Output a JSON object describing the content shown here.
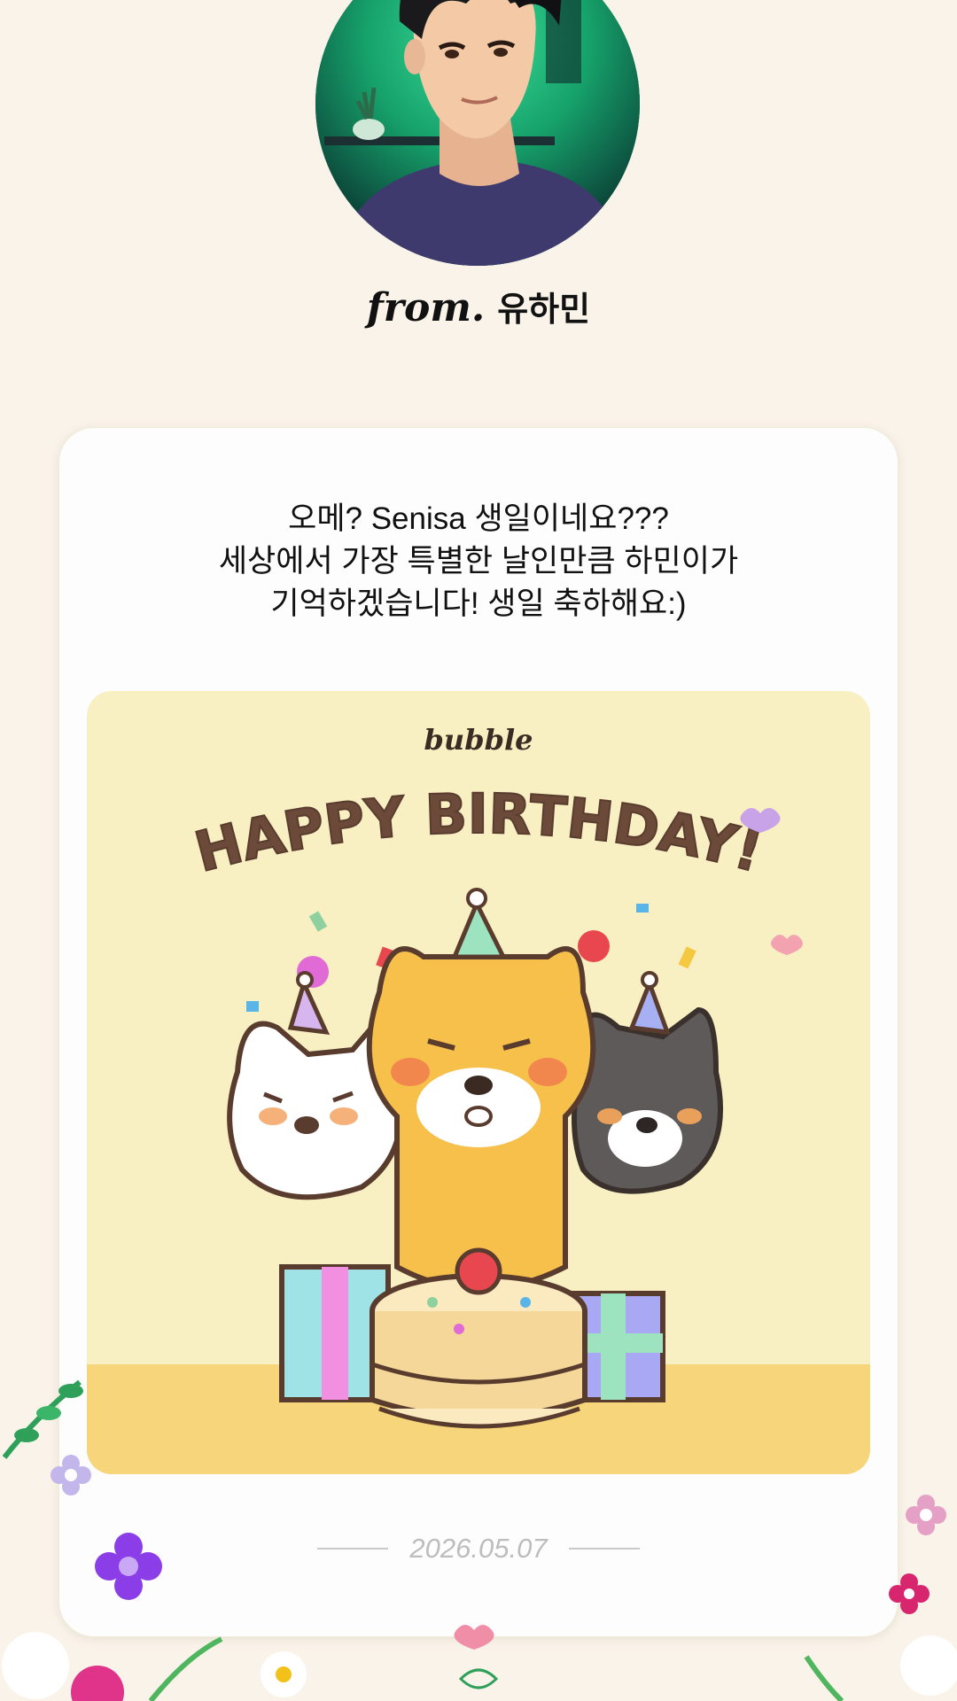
{
  "sender": {
    "from_label": "from.",
    "name": "유하민"
  },
  "message": {
    "lines": [
      "오메? Senisa 생일이네요???",
      "세상에서 가장 특별한 날인만큼 하민이가",
      "기억하겠습니다! 생일 축하해요:)"
    ]
  },
  "card_image": {
    "brand": "bubble",
    "headline": "HAPPY BIRTHDAY!"
  },
  "date": "2026.05.07",
  "colors": {
    "background": "#faf3ea",
    "card": "#fdfdfd",
    "image_bg": "#f8efc2",
    "headline": "#6b4a3a",
    "date_text": "#bdbdbd"
  }
}
